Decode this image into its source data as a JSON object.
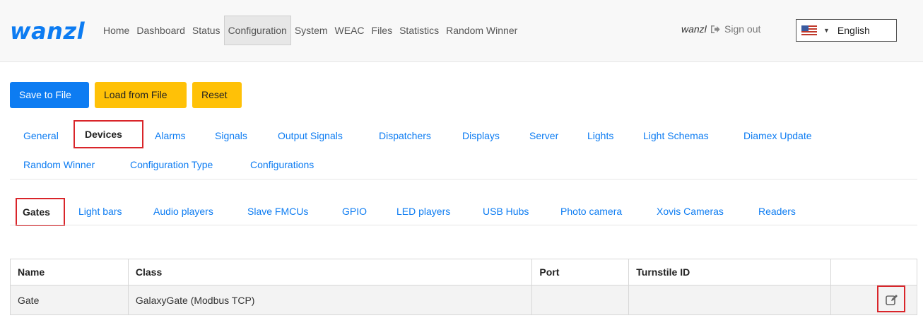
{
  "brand": {
    "logo_text": "wanzl",
    "logo_color": "#0d7cf2"
  },
  "nav": {
    "items": [
      {
        "label": "Home"
      },
      {
        "label": "Dashboard"
      },
      {
        "label": "Status"
      },
      {
        "label": "Configuration"
      },
      {
        "label": "System"
      },
      {
        "label": "WEAC"
      },
      {
        "label": "Files"
      },
      {
        "label": "Statistics"
      },
      {
        "label": "Random Winner"
      }
    ],
    "active": "Configuration",
    "user": "wanzl",
    "signout_label": "Sign out",
    "language": {
      "selected": "English",
      "flag_icon": "us-flag-icon"
    }
  },
  "actions": {
    "save_label": "Save to File",
    "load_label": "Load from File",
    "reset_label": "Reset"
  },
  "config_tabs": {
    "items": [
      {
        "label": "General"
      },
      {
        "label": "Devices"
      },
      {
        "label": "Alarms"
      },
      {
        "label": "Signals"
      },
      {
        "label": "Output Signals"
      },
      {
        "label": "Dispatchers"
      },
      {
        "label": "Displays"
      },
      {
        "label": "Server"
      },
      {
        "label": "Lights"
      },
      {
        "label": "Light Schemas"
      },
      {
        "label": "Diamex Update"
      },
      {
        "label": "Random Winner"
      },
      {
        "label": "Configuration Type"
      },
      {
        "label": "Configurations"
      }
    ],
    "active": "Devices"
  },
  "device_tabs": {
    "items": [
      {
        "label": "Gates"
      },
      {
        "label": "Light bars"
      },
      {
        "label": "Audio players"
      },
      {
        "label": "Slave FMCUs"
      },
      {
        "label": "GPIO"
      },
      {
        "label": "LED players"
      },
      {
        "label": "USB Hubs"
      },
      {
        "label": "Photo camera"
      },
      {
        "label": "Xovis Cameras"
      },
      {
        "label": "Readers"
      }
    ],
    "active": "Gates"
  },
  "table": {
    "columns": [
      "Name",
      "Class",
      "Port",
      "Turnstile ID",
      ""
    ],
    "rows": [
      {
        "name": "Gate",
        "class": "GalaxyGate (Modbus TCP)",
        "port": "",
        "turnstile_id": "",
        "action_icon": "edit-icon"
      }
    ]
  },
  "colors": {
    "primary": "#0d7cf2",
    "warning": "#ffc107",
    "highlight": "#d9252a"
  }
}
